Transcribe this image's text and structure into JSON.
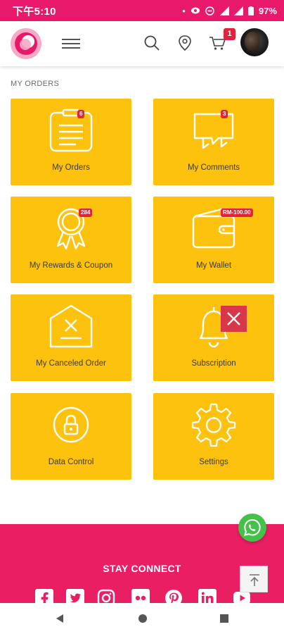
{
  "status_bar": {
    "time": "下午5:10",
    "battery": "97%"
  },
  "header": {
    "cart_count": "1"
  },
  "section": {
    "title": "MY ORDERS"
  },
  "tiles": [
    {
      "label": "My Orders",
      "badge": "6"
    },
    {
      "label": "My Comments",
      "badge": "3"
    },
    {
      "label": "My Rewards & Coupon",
      "badge": "284"
    },
    {
      "label": "My Wallet",
      "badge": "RM-100.00"
    },
    {
      "label": "My Canceled Order"
    },
    {
      "label": "Subscription"
    },
    {
      "label": "Data Control"
    },
    {
      "label": "Settings"
    }
  ],
  "footer": {
    "title": "STAY CONNECT"
  },
  "colors": {
    "brand": "#e8196a",
    "tile": "#fcc20d",
    "badge": "#e0243b",
    "whatsapp": "#45c04a"
  },
  "icons": [
    "logo-icon",
    "menu-icon",
    "search-icon",
    "location-icon",
    "cart-icon",
    "facebook-icon",
    "twitter-icon",
    "instagram-icon",
    "flickr-icon",
    "pinterest-icon",
    "linkedin-icon",
    "youtube-icon",
    "whatsapp-icon",
    "arrow-up-icon"
  ]
}
